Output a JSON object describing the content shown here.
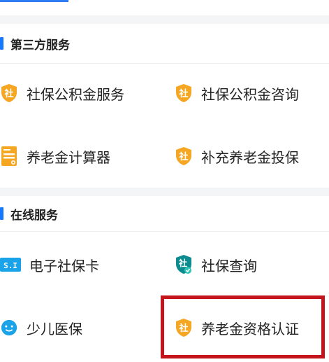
{
  "sections": [
    {
      "title": "第三方服务",
      "items": [
        {
          "label": "社保公积金服务",
          "icon": "shield-she-icon"
        },
        {
          "label": "社保公积金咨询",
          "icon": "shield-she-icon"
        },
        {
          "label": "养老金计算器",
          "icon": "calculator-icon"
        },
        {
          "label": "补充养老金投保",
          "icon": "shield-she-icon"
        }
      ]
    },
    {
      "title": "在线服务",
      "items": [
        {
          "label": "电子社保卡",
          "icon": "si-card-icon",
          "icon_text": "S.I"
        },
        {
          "label": "社保查询",
          "icon": "shield-check-icon"
        },
        {
          "label": "少儿医保",
          "icon": "child-face-icon"
        },
        {
          "label": "养老金资格认证",
          "icon": "shield-she-icon"
        }
      ]
    }
  ],
  "shield_glyph": "社",
  "colors": {
    "accent": "#1677ff",
    "shield": "#f5a623",
    "teal": "#0d8c8f",
    "highlight": "#c3151b"
  }
}
